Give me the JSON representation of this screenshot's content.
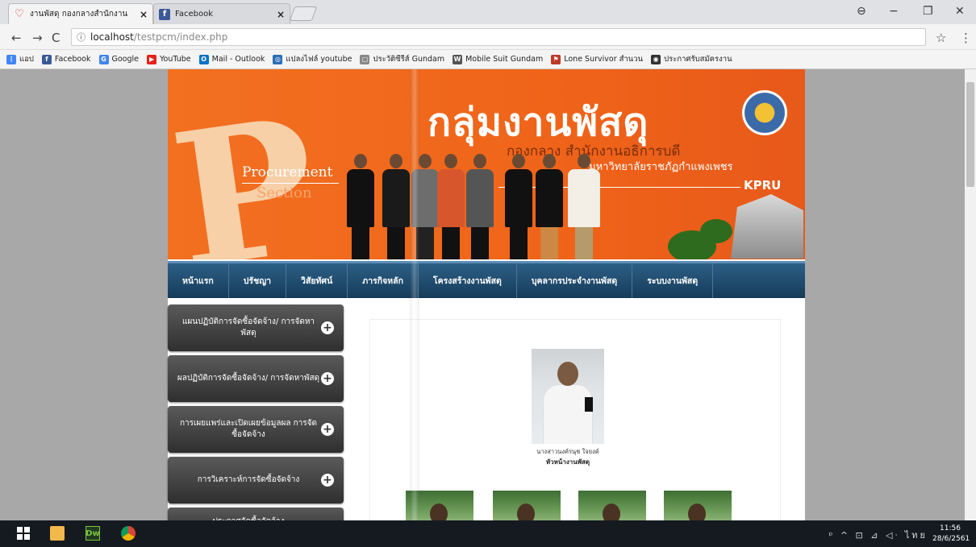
{
  "browser": {
    "tabs": [
      {
        "title": "งานพัสดุ กองกลางสำนักงาน",
        "active": true
      },
      {
        "title": "Facebook",
        "active": false
      }
    ],
    "url_host": "localhost",
    "url_path": "/testpcm/index.php",
    "star_icon": "☆",
    "menu_icon": "⋮",
    "bookmarks": [
      {
        "label": "แอป",
        "icon": "apps-grid-icon",
        "color": "#4285f4",
        "glyph": "⋮"
      },
      {
        "label": "Facebook",
        "icon": "facebook-icon",
        "color": "#3b5998",
        "glyph": "f"
      },
      {
        "label": "Google",
        "icon": "google-icon",
        "color": "#4285f4",
        "glyph": "G"
      },
      {
        "label": "YouTube",
        "icon": "youtube-icon",
        "color": "#e62117",
        "glyph": "▶"
      },
      {
        "label": "Mail - Outlook",
        "icon": "outlook-icon",
        "color": "#0072c6",
        "glyph": "O"
      },
      {
        "label": "แปลงไฟล์ youtube",
        "icon": "converter-icon",
        "color": "#2a6fb5",
        "glyph": "◎"
      },
      {
        "label": "ประวัติซีรีส์ Gundam",
        "icon": "page-icon",
        "color": "#888888",
        "glyph": "▢"
      },
      {
        "label": "Mobile Suit Gundam",
        "icon": "wordpress-icon",
        "color": "#555555",
        "glyph": "W"
      },
      {
        "label": "Lone Survivor สำนวน",
        "icon": "bookmark-icon",
        "color": "#c0392b",
        "glyph": "⚑"
      },
      {
        "label": "ประกาศรับสมัครงาน",
        "icon": "globe-icon",
        "color": "#333333",
        "glyph": "◉"
      }
    ]
  },
  "site": {
    "banner": {
      "logo_letter": "P",
      "procurement": "rocurement",
      "section": "Section",
      "title_th": "กลุ่มงานพัสดุ",
      "subtitle_1": "กองกลาง สำนักงานอธิการบดี",
      "subtitle_2": "มหาวิทยาลัยราชภัฏกำแพงเพชร",
      "kpru": "KPRU"
    },
    "nav": [
      "หน้าแรก",
      "ปรัชญา",
      "วิสัยทัศน์",
      "ภารกิจหลัก",
      "โครงสร้างงานพัสดุ",
      "บุคลากรประจำงานพัสดุ",
      "ระบบงานพัสดุ"
    ],
    "sidebar": [
      {
        "label": "แผนปฏิบัติการจัดซื้อจัดจ้าง/ การจัดหาพัสดุ"
      },
      {
        "label": "ผลปฏิบัติการจัดซื้อจัดจ้าง/ การจัดหาพัสดุ"
      },
      {
        "label": "การเผยแพร่และเปิดเผยข้อมูลผล การจัดซื้อจัดจ้าง"
      },
      {
        "label": "การวิเคราะห์การจัดซื้อจัดจ้าง"
      },
      {
        "label": "ประกาศจัดซื้อจัดจ้าง"
      }
    ],
    "chief": {
      "name": "นางสาวนงค์รนุช ใจยงค์",
      "role": "หัวหน้างานพัสดุ"
    }
  },
  "taskbar": {
    "tray": "ᵖ ^ ⊡ ⊿ ◁ᐧ ไทย",
    "time": "11:56",
    "date": "28/6/2561"
  }
}
